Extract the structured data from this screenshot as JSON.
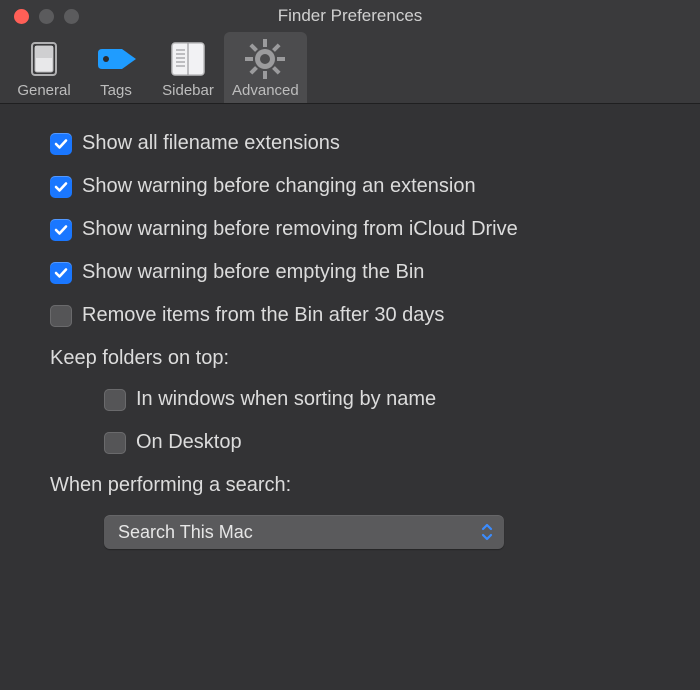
{
  "window": {
    "title": "Finder Preferences"
  },
  "tabs": [
    {
      "label": "General"
    },
    {
      "label": "Tags"
    },
    {
      "label": "Sidebar"
    },
    {
      "label": "Advanced"
    }
  ],
  "checkboxes": {
    "show_extensions": {
      "label": "Show all filename extensions",
      "checked": true
    },
    "warn_change_ext": {
      "label": "Show warning before changing an extension",
      "checked": true
    },
    "warn_icloud_remove": {
      "label": "Show warning before removing from iCloud Drive",
      "checked": true
    },
    "warn_empty_bin": {
      "label": "Show warning before emptying the Bin",
      "checked": true
    },
    "remove_30_days": {
      "label": "Remove items from the Bin after 30 days",
      "checked": false
    }
  },
  "keep_folders": {
    "header": "Keep folders on top:",
    "in_windows": {
      "label": "In windows when sorting by name",
      "checked": false
    },
    "on_desktop": {
      "label": "On Desktop",
      "checked": false
    }
  },
  "search": {
    "header": "When performing a search:",
    "selected": "Search This Mac"
  }
}
